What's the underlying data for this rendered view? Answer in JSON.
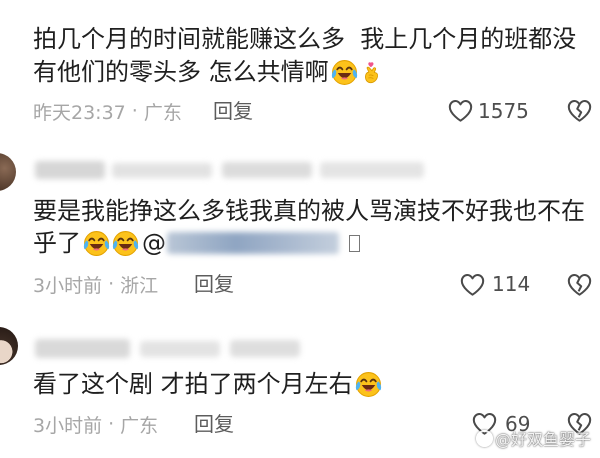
{
  "separator": "·",
  "comments": [
    {
      "lines": [
        "拍几个月的时间就能赚这么多  我上几个月的班都没",
        "有他们的零头多 怎么共情啊"
      ],
      "trailing_emojis": [
        "laughing-crying-face-icon",
        "finger-heart-icon"
      ],
      "time": "昨天23:37",
      "location": "广东",
      "reply_label": "回复",
      "likes": "1575"
    },
    {
      "lines": [
        "要是我能挣这么多钱我真的被人骂演技不好我也不在",
        "乎了"
      ],
      "trailing_emojis": [
        "laughing-crying-face-icon",
        "laughing-crying-face-icon"
      ],
      "mention_prefix": "@",
      "time": "3小时前",
      "location": "浙江",
      "reply_label": "回复",
      "likes": "114"
    },
    {
      "lines": [
        "看了这个剧 才拍了两个月左右"
      ],
      "trailing_emojis": [
        "laughing-crying-face-icon"
      ],
      "time": "3小时前",
      "location": "广东",
      "reply_label": "回复",
      "likes": "69"
    }
  ],
  "icons": {
    "like": "heart-outline-icon",
    "dislike": "broken-heart-icon",
    "emoji_laugh": "laughing-crying-face-icon",
    "emoji_finger_heart": "finger-heart-icon"
  },
  "colors": {
    "text": "#1f1f1f",
    "meta": "#a6a6a6",
    "icon_stroke": "#4a4a4a",
    "emoji_yellow": "#fcc21b",
    "tear_blue": "#4fb3f0"
  },
  "watermark": "@好双鱼婴子"
}
